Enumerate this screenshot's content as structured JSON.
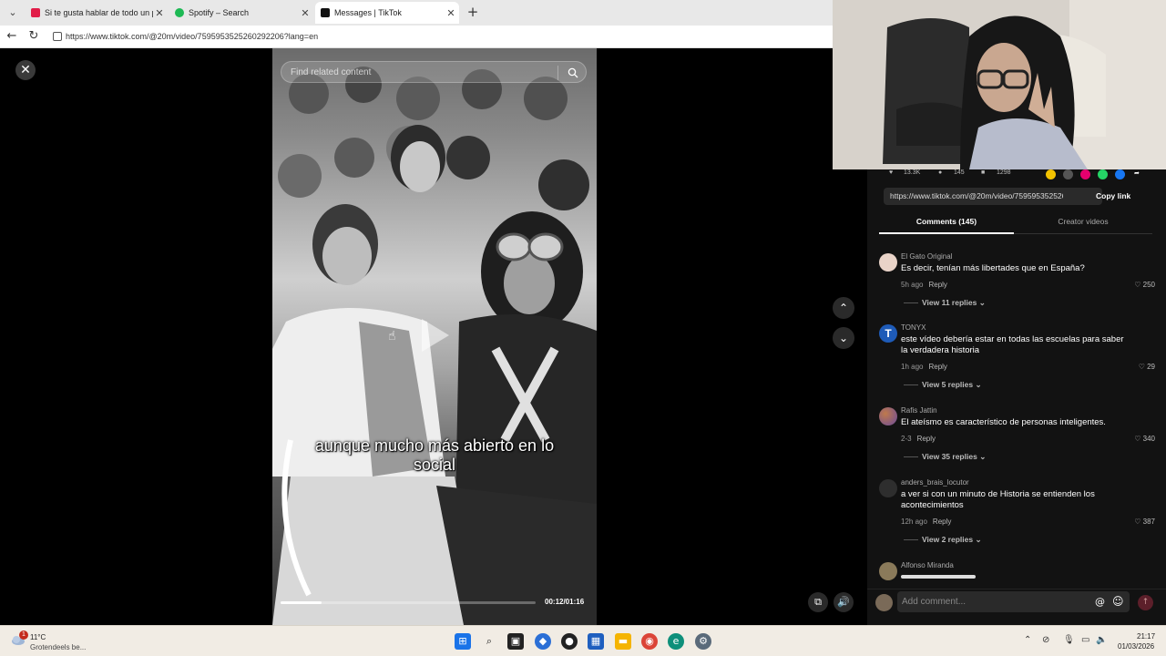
{
  "browser": {
    "tabs": [
      {
        "label": "Si te gusta hablar de todo un poco",
        "favicon_color": "#e11d48"
      },
      {
        "label": "Spotify – Search",
        "favicon_color": "#1db954"
      },
      {
        "label": "Messages | TikTok",
        "favicon_color": "#111111"
      }
    ],
    "url": "https://www.tiktok.com/@20m/video/7595953525260292206?lang=en"
  },
  "video": {
    "search_placeholder": "Find related content",
    "subtitle": "aunque mucho más abierto en lo social",
    "time": "00:12/01:16",
    "progress": 0.16
  },
  "panel": {
    "stats": {
      "likes": "13.3K",
      "comments": "145",
      "saves": "1298"
    },
    "link": "https://www.tiktok.com/@20m/video/7595953525260...",
    "copy_link": "Copy link",
    "tab_comments": "Comments (145)",
    "tab_creator": "Creator videos",
    "reply_label": "Reply",
    "comments": [
      {
        "user": "El Gato Original",
        "text": "Es decir, tenían más libertades que en España?",
        "time": "5h ago",
        "likes": "250",
        "view_replies": "View 11 replies",
        "avatar_color": "#c0392b"
      },
      {
        "user": "TONYX",
        "text": "este vídeo debería estar en todas las escuelas para saber la verdadera historia",
        "time": "1h ago",
        "likes": "29",
        "view_replies": "View 5 replies",
        "avatar_color": "#1e5bb8"
      },
      {
        "user": "Rafis Jattin",
        "text": "El ateísmo es característico de personas inteligentes.",
        "time": "2-3",
        "likes": "340",
        "view_replies": "View 35 replies",
        "avatar_color": "#8e6bbf"
      },
      {
        "user": "anders_brais_locutor",
        "text": "a ver si con un minuto de Historia se entienden los acontecimientos",
        "time": "12h ago",
        "likes": "387",
        "view_replies": "View 2 replies",
        "avatar_color": "#3a3a3a"
      },
      {
        "user": "Alfonso Miranda",
        "text": "",
        "time": "",
        "likes": "",
        "view_replies": "",
        "avatar_color": "#8a7a5a"
      }
    ],
    "add_comment_placeholder": "Add comment..."
  },
  "taskbar": {
    "temperature": "11°C",
    "condition": "Grotendeels be...",
    "notification_count": "1",
    "time": "21:17",
    "date": "01/03/2026"
  }
}
